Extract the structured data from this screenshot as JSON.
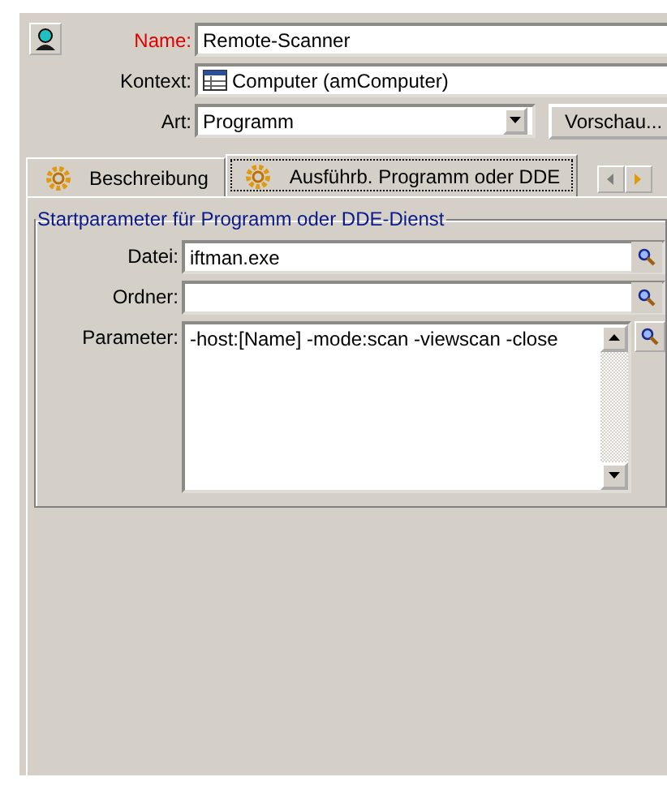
{
  "header_fields": [
    {
      "label": "Name:",
      "value": "Remote-Scanner",
      "required": true,
      "kind": "text"
    },
    {
      "label": "Kontext:",
      "value": "Computer (amComputer)",
      "required": false,
      "kind": "table"
    },
    {
      "label": "Art:",
      "value": "Programm",
      "required": false,
      "kind": "select"
    }
  ],
  "preview_button": "Vorschau...",
  "tabs": [
    {
      "label": "Beschreibung",
      "selected": false
    },
    {
      "label": "Ausführb. Programm oder DDE",
      "selected": true
    }
  ],
  "group": {
    "title": "Startparameter für Programm oder DDE-Dienst",
    "fields": [
      {
        "label": "Datei:",
        "value": "iftman.exe",
        "kind": "line"
      },
      {
        "label": "Ordner:",
        "kind": "line"
      },
      {
        "label": "Parameter:",
        "value": "-host:[Name] -mode:scan -viewscan -close",
        "kind": "multiline"
      }
    ]
  }
}
